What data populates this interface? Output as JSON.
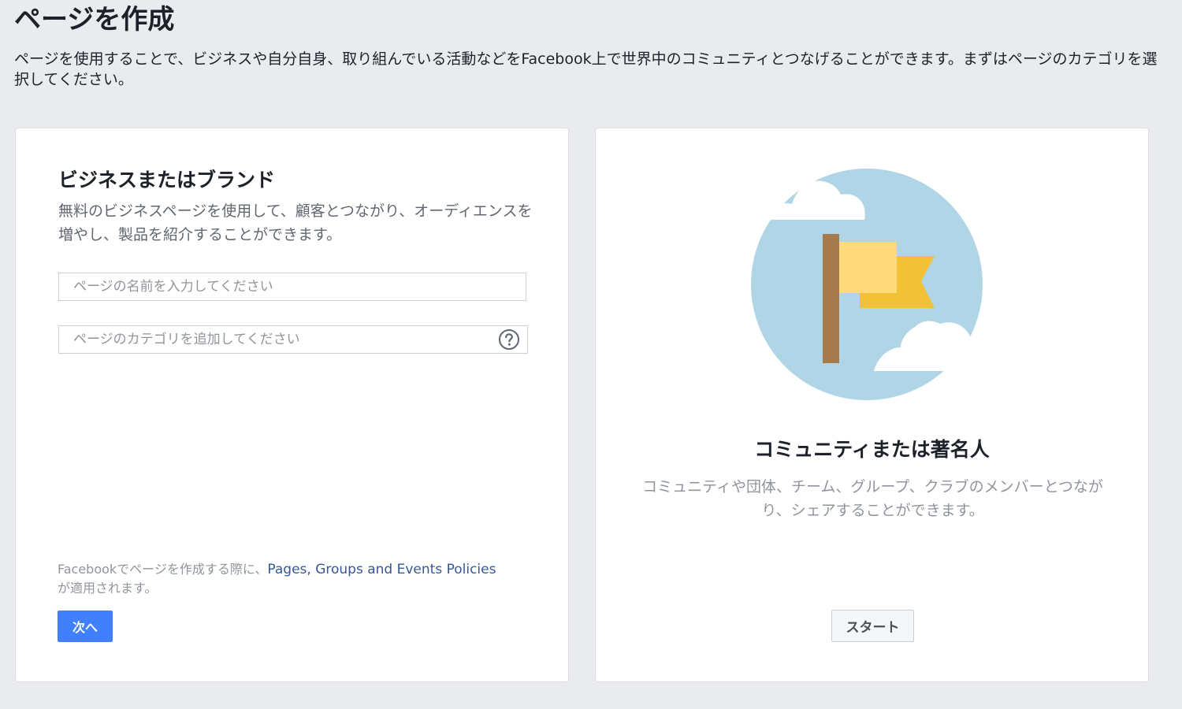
{
  "header": {
    "title": "ページを作成",
    "description": "ページを使用することで、ビジネスや自分自身、取り組んでいる活動などをFacebook上で世界中のコミュニティとつなげることができます。まずはページのカテゴリを選択してください。"
  },
  "business_card": {
    "title": "ビジネスまたはブランド",
    "description": "無料のビジネスページを使用して、顧客とつながり、オーディエンスを増やし、製品を紹介することができます。",
    "name_input": {
      "value": "",
      "placeholder": "ページの名前を入力してください"
    },
    "category_input": {
      "value": "",
      "placeholder": "ページのカテゴリを追加してください"
    },
    "help_icon": "question-circle-icon",
    "policy": {
      "prefix": "Facebookでページを作成する際に、",
      "link_label": "Pages, Groups and Events Policies",
      "suffix": "が適用されます。"
    },
    "next_label": "次へ"
  },
  "community_card": {
    "illustration_icon": "flag-illustration",
    "title": "コミュニティまたは著名人",
    "description": "コミュニティや団体、チーム、グループ、クラブのメンバーとつながり、シェアすることができます。",
    "start_label": "スタート"
  },
  "colors": {
    "background": "#e9ebee",
    "primary_button": "#4080ff",
    "link": "#365899",
    "secondary_text": "#606770",
    "muted_text": "#90949c",
    "sky": "#b0d5e6",
    "flag_pole": "#a57a4c",
    "flag_light": "#ffd97a",
    "flag_dark": "#f3c136"
  }
}
